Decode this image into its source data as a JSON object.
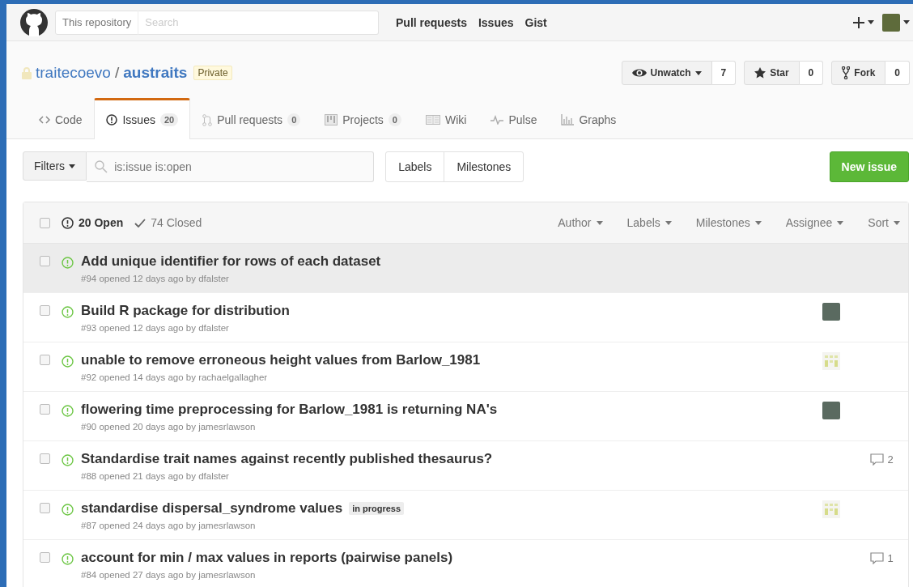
{
  "header": {
    "search_scope": "This repository",
    "search_placeholder": "Search",
    "nav": [
      "Pull requests",
      "Issues",
      "Gist"
    ]
  },
  "repo": {
    "owner": "traitecoevo",
    "separator": "/",
    "name": "austraits",
    "badge": "Private",
    "actions": [
      {
        "label": "Unwatch",
        "caret": true,
        "count": "7"
      },
      {
        "label": "Star",
        "caret": false,
        "count": "0"
      },
      {
        "label": "Fork",
        "caret": false,
        "count": "0"
      }
    ]
  },
  "tabs": [
    {
      "label": "Code",
      "selected": false
    },
    {
      "label": "Issues",
      "count": "20",
      "selected": true
    },
    {
      "label": "Pull requests",
      "count": "0",
      "selected": false
    },
    {
      "label": "Projects",
      "count": "0",
      "selected": false
    },
    {
      "label": "Wiki",
      "selected": false
    },
    {
      "label": "Pulse",
      "selected": false
    },
    {
      "label": "Graphs",
      "selected": false
    }
  ],
  "filter_bar": {
    "filters_label": "Filters",
    "query": "is:issue is:open",
    "links": [
      "Labels",
      "Milestones"
    ],
    "new_button": "New issue"
  },
  "issue_list": {
    "header": {
      "checked": false,
      "open": "20 Open",
      "closed": "74 Closed",
      "menus": [
        "Author",
        "Labels",
        "Milestones",
        "Assignee",
        "Sort"
      ]
    },
    "issues": [
      {
        "title": "Add unique identifier for rows of each dataset",
        "meta": "#94 opened 12 days ago by dfalster",
        "checked": false,
        "hovered": true
      },
      {
        "title": "Build R package for distribution",
        "meta": "#93 opened 12 days ago by dfalster",
        "checked": false,
        "hovered": false,
        "assignee": {
          "kind": "photo"
        }
      },
      {
        "title": "unable to remove erroneous height values from Barlow_1981",
        "meta": "#92 opened 14 days ago by rachaelgallagher",
        "checked": false,
        "hovered": false,
        "assignee": {
          "kind": "identicon"
        }
      },
      {
        "title": "flowering time preprocessing for Barlow_1981 is returning NA's",
        "meta": "#90 opened 20 days ago by jamesrlawson",
        "checked": false,
        "hovered": false,
        "assignee": {
          "kind": "photo"
        }
      },
      {
        "title": "Standardise trait names against recently published thesaurus?",
        "meta": "#88 opened 21 days ago by dfalster",
        "checked": false,
        "hovered": false,
        "comments": "2"
      },
      {
        "title": "standardise dispersal_syndrome values",
        "labels": [
          {
            "text": "in progress",
            "color": "#ededed"
          }
        ],
        "meta": "#87 opened 24 days ago by jamesrlawson",
        "checked": false,
        "hovered": false,
        "assignee": {
          "kind": "identicon"
        }
      },
      {
        "title": "account for min / max values in reports (pairwise panels)",
        "meta": "#84 opened 27 days ago by jamesrlawson",
        "checked": false,
        "hovered": false,
        "comments": "1"
      }
    ]
  }
}
